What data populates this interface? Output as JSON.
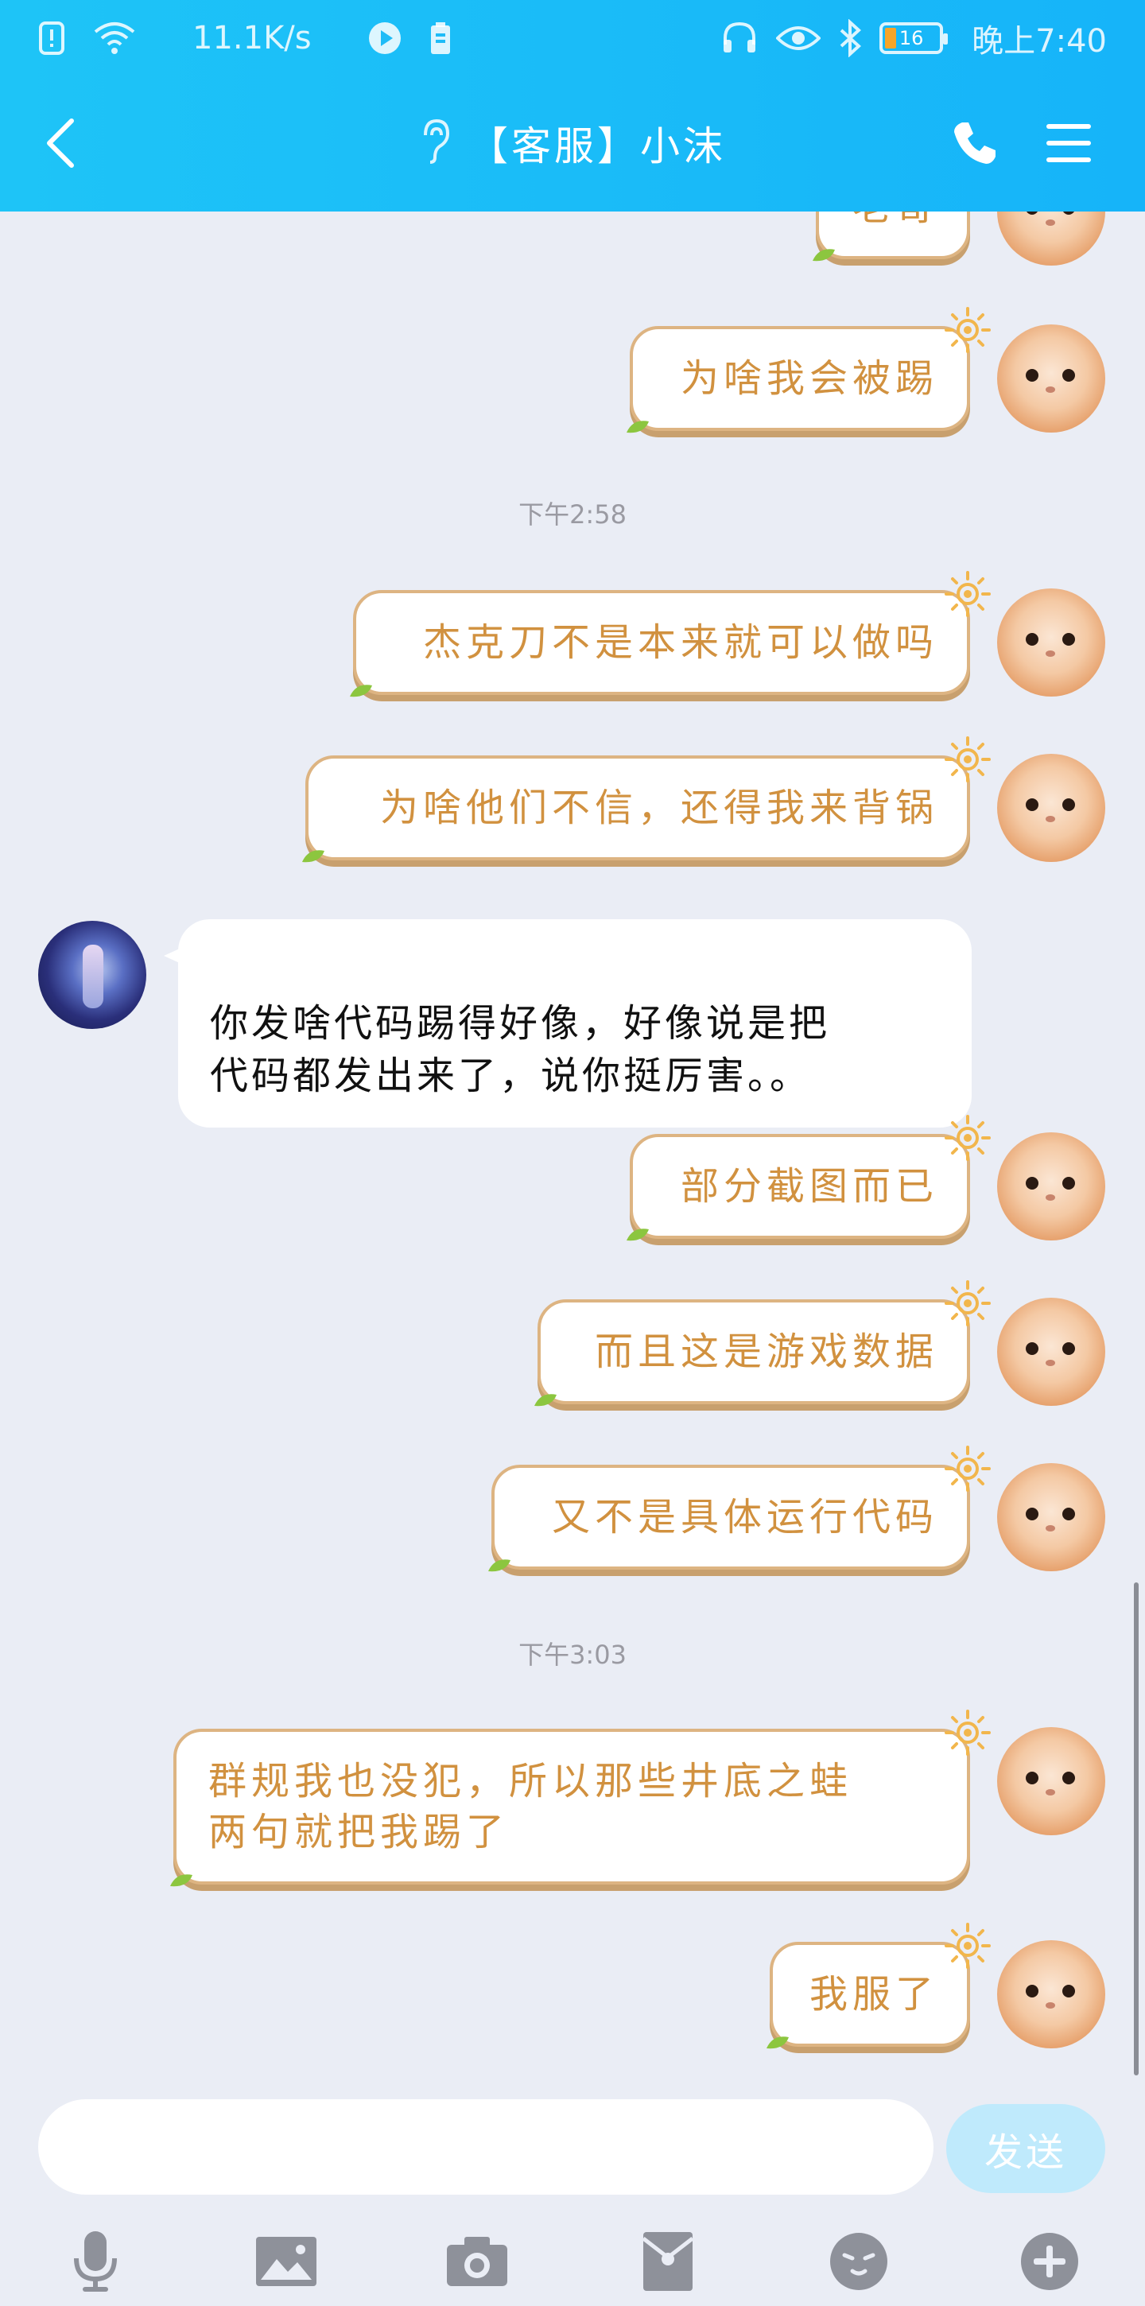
{
  "status_bar": {
    "net_speed": "11.1K/s",
    "battery_level": "16",
    "time": "晚上7:40"
  },
  "header": {
    "title": "【客服】小沫"
  },
  "chat": {
    "items": [
      {
        "type": "me",
        "text": "老哥"
      },
      {
        "type": "me",
        "text": "为啥我会被踢"
      },
      {
        "type": "timestamp",
        "text": "下午2:58"
      },
      {
        "type": "me",
        "text": "杰克刀不是本来就可以做吗"
      },
      {
        "type": "me",
        "text": "为啥他们不信，还得我来背锅"
      },
      {
        "type": "other",
        "text": "你发啥代码踢得好像，好像说是把\n代码都发出来了，说你挺厉害。。"
      },
      {
        "type": "me",
        "text": "部分截图而已"
      },
      {
        "type": "me",
        "text": "而且这是游戏数据"
      },
      {
        "type": "me",
        "text": "又不是具体运行代码"
      },
      {
        "type": "timestamp",
        "text": "下午3:03"
      },
      {
        "type": "me",
        "text": "群规我也没犯，所以那些井底之蛙\n两句就把我踢了"
      },
      {
        "type": "me",
        "text": "我服了"
      }
    ]
  },
  "input": {
    "placeholder": "",
    "send_label": "发送"
  },
  "colors": {
    "header": "#16b4f9",
    "bubble_me_text": "#d1913f",
    "bubble_me_border": "#ddb482",
    "chat_bg": "#eaedf5",
    "send_btn": "#bfeafc"
  },
  "toolbar": {
    "icons": [
      "microphone-icon",
      "image-icon",
      "camera-icon",
      "red-packet-icon",
      "emoji-icon",
      "plus-icon"
    ]
  }
}
